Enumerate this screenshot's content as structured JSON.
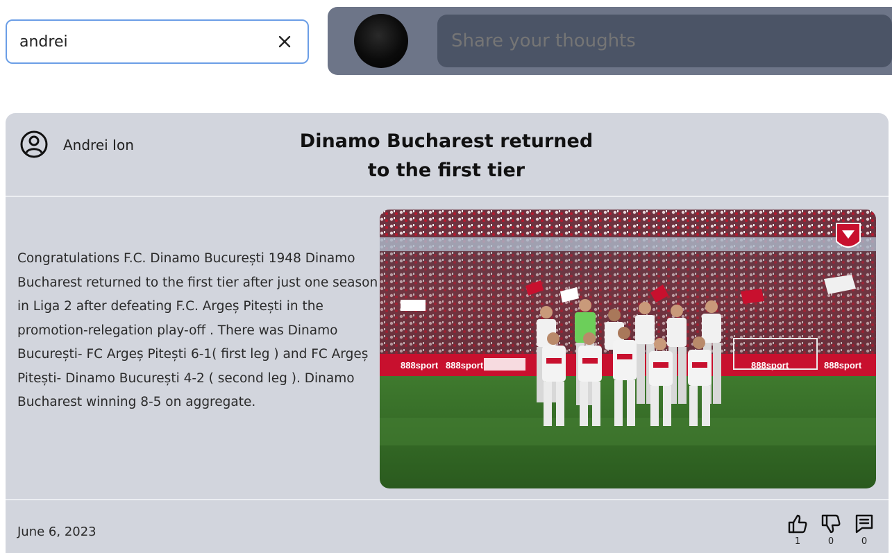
{
  "search": {
    "value": "andrei",
    "clear_icon": "close-icon"
  },
  "composer": {
    "avatar_icon": "user-avatar",
    "placeholder": "Share your thoughts"
  },
  "post": {
    "author": "Andrei Ion",
    "author_icon": "user-circle-icon",
    "title_line1": "Dinamo Bucharest returned",
    "title_line2": "to the first tier",
    "body": "Congratulations F.C. Dinamo București 1948 Dinamo Bucharest returned to the first tier after just one season in Liga 2 after defeating F.C. Argeș Pitești in the promotion-relegation play-off . There was Dinamo București- FC Argeș Pitești 6-1( first leg ) and FC Argeș Pitești- Dinamo București 4-2 ( second leg ). Dinamo Bucharest winning 8-5 on aggregate.",
    "image_banner_texts": [
      "888sport",
      "888sport",
      "888sport",
      "888sport"
    ],
    "date": "June 6, 2023",
    "actions": {
      "likes": "1",
      "dislikes": "0",
      "comments": "0"
    }
  },
  "colors": {
    "composer_bg": "#6d7588",
    "composer_input_bg": "#4b5466",
    "card_bg": "#d2d5dd",
    "search_border": "#6b9ee6",
    "dinamo_red": "#c8102e"
  }
}
